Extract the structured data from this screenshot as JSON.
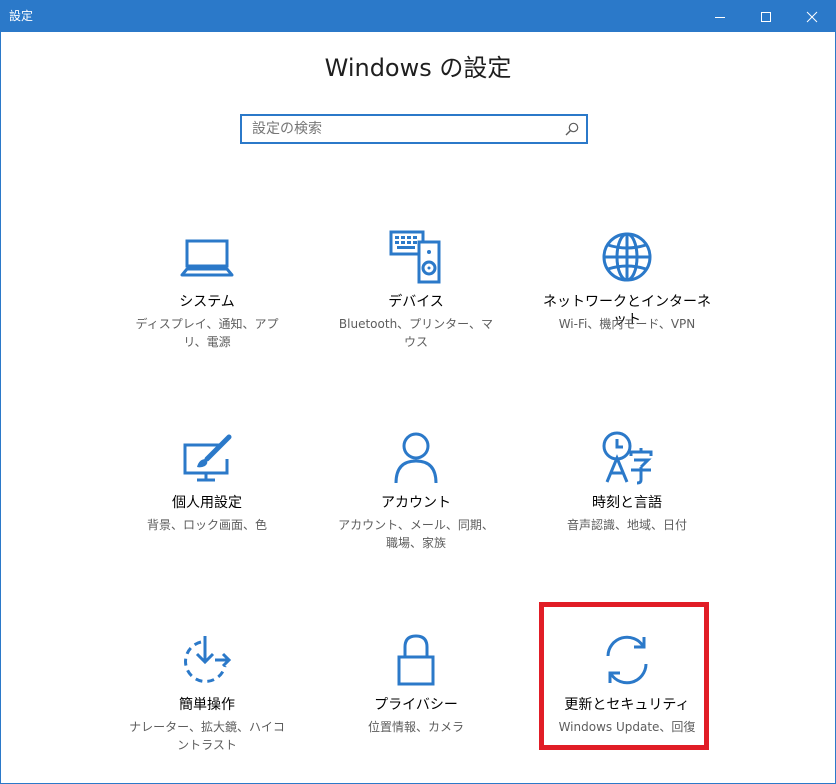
{
  "window": {
    "title": "設定"
  },
  "page": {
    "heading": "Windows の設定"
  },
  "search": {
    "placeholder": "設定の検索",
    "value": ""
  },
  "tiles": [
    {
      "label": "システム",
      "desc": "ディスプレイ、通知、アプリ、電源",
      "icon": "laptop-icon"
    },
    {
      "label": "デバイス",
      "desc": "Bluetooth、プリンター、マウス",
      "icon": "keyboard-speaker-icon"
    },
    {
      "label": "ネットワークとインターネット",
      "desc": "Wi-Fi、機内モード、VPN",
      "icon": "globe-icon"
    },
    {
      "label": "個人用設定",
      "desc": "背景、ロック画面、色",
      "icon": "paintbrush-monitor-icon"
    },
    {
      "label": "アカウント",
      "desc": "アカウント、メール、同期、職場、家族",
      "icon": "person-icon"
    },
    {
      "label": "時刻と言語",
      "desc": "音声認識、地域、日付",
      "icon": "clock-language-icon"
    },
    {
      "label": "簡単操作",
      "desc": "ナレーター、拡大鏡、ハイコントラスト",
      "icon": "ease-of-access-icon"
    },
    {
      "label": "プライバシー",
      "desc": "位置情報、カメラ",
      "icon": "lock-icon"
    },
    {
      "label": "更新とセキュリティ",
      "desc": "Windows Update、回復",
      "icon": "sync-arrows-icon"
    }
  ],
  "colors": {
    "accent": "#2b79c9",
    "highlight": "#e11d26"
  }
}
